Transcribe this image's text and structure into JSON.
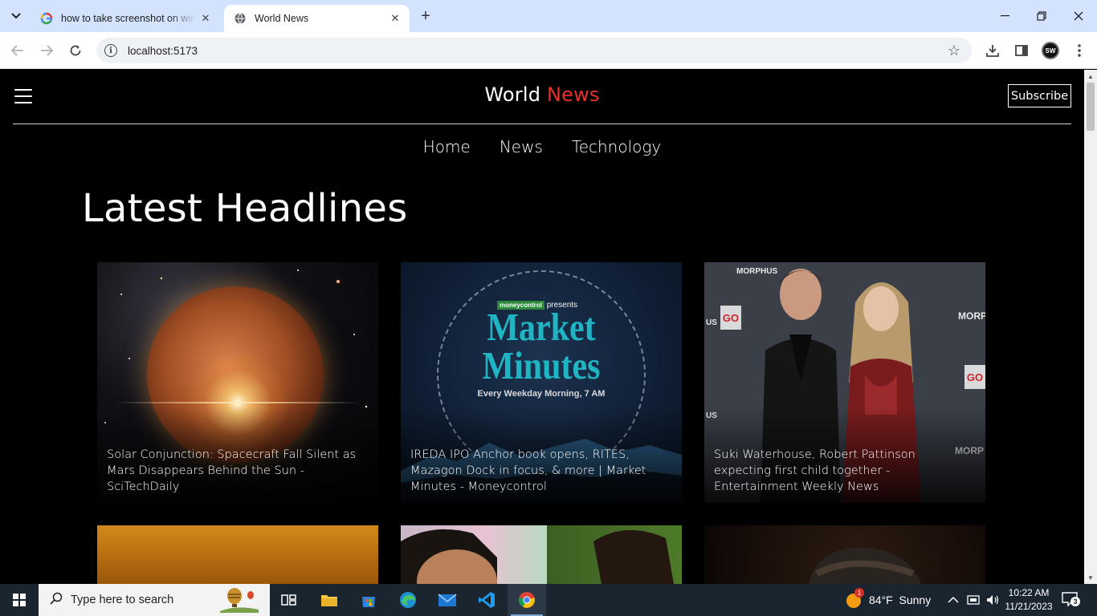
{
  "browser": {
    "tabs": [
      {
        "title": "how to take screenshot on windows",
        "favicon": "google-icon"
      },
      {
        "title": "World News",
        "favicon": "globe-icon"
      }
    ],
    "address": "localhost:5173"
  },
  "site": {
    "brand_primary": "World",
    "brand_accent": "News",
    "accent_color": "#e8302e",
    "subscribe_label": "Subscribe",
    "nav": [
      "Home",
      "News",
      "Technology"
    ],
    "section_title": "Latest Headlines",
    "articles": [
      {
        "title": "Solar Conjunction: Spacecraft Fall Silent as Mars Disappears Behind the Sun - SciTechDaily"
      },
      {
        "title": "IREDA IPO Anchor book opens, RITES, Mazagon Dock in focus, & more | Market Minutes - Moneycontrol"
      },
      {
        "title": "Suki Waterhouse, Robert Pattinson expecting first child together - Entertainment Weekly News"
      }
    ],
    "card_art": {
      "market_brand": "moneycontrol",
      "market_presents": "presents",
      "market_title_1": "Market",
      "market_title_2": "Minutes",
      "market_subtitle": "Every Weekday Morning, 7 AM",
      "wall_brand": "MORPHUS",
      "wall_brand_partial": "MORP",
      "wall_brand_partial_2": "MORPHUS",
      "go_badge": "GO",
      "wall_us": "US"
    }
  },
  "taskbar": {
    "search_placeholder": "Type here to search",
    "weather_badge": "1",
    "weather": "84°F  Sunny",
    "time": "10:22 AM",
    "date": "11/21/2023",
    "notifications": "3"
  }
}
